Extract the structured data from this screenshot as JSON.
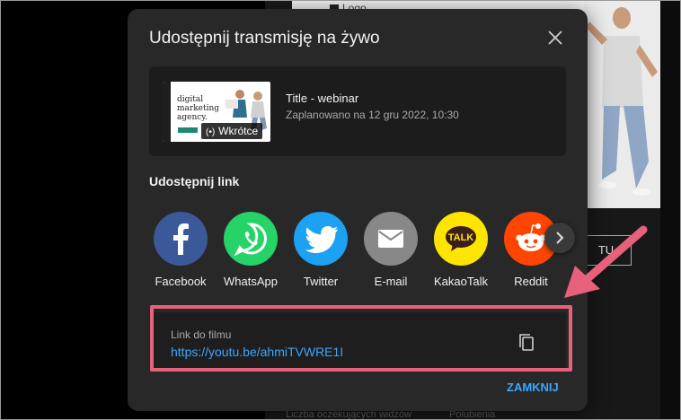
{
  "background": {
    "page_logo": "Logo",
    "partial_button": "TU",
    "footer_left": "Liczba oczekujących widzów",
    "footer_right": "Polubienia"
  },
  "dialog": {
    "title": "Udostępnij transmisję na żywo",
    "close_icon": "close-icon",
    "preview": {
      "thumb_text": [
        "digital",
        "marketing",
        "agency."
      ],
      "badge": "Wkrótce",
      "title": "Title - webinar",
      "scheduled": "Zaplanowano na 12 gru 2022, 10:30"
    },
    "share_label": "Udostępnij link",
    "social": [
      {
        "name": "Facebook",
        "color": "#3b5998",
        "icon": "facebook-icon"
      },
      {
        "name": "WhatsApp",
        "color": "#25d366",
        "icon": "whatsapp-icon"
      },
      {
        "name": "Twitter",
        "color": "#1da1f2",
        "icon": "twitter-icon"
      },
      {
        "name": "E-mail",
        "color": "#888888",
        "icon": "email-icon"
      },
      {
        "name": "KakaoTalk",
        "color": "#fee500",
        "icon": "kakaotalk-icon",
        "icon_text": "TALK"
      },
      {
        "name": "Reddit",
        "color": "#ff4500",
        "icon": "reddit-icon"
      }
    ],
    "link": {
      "label": "Link do filmu",
      "url": "https://youtu.be/ahmiTVWRE1I"
    },
    "close_button": "ZAMKNIJ"
  },
  "colors": {
    "accent_link": "#3ea6ff",
    "highlight": "#e8617a"
  }
}
